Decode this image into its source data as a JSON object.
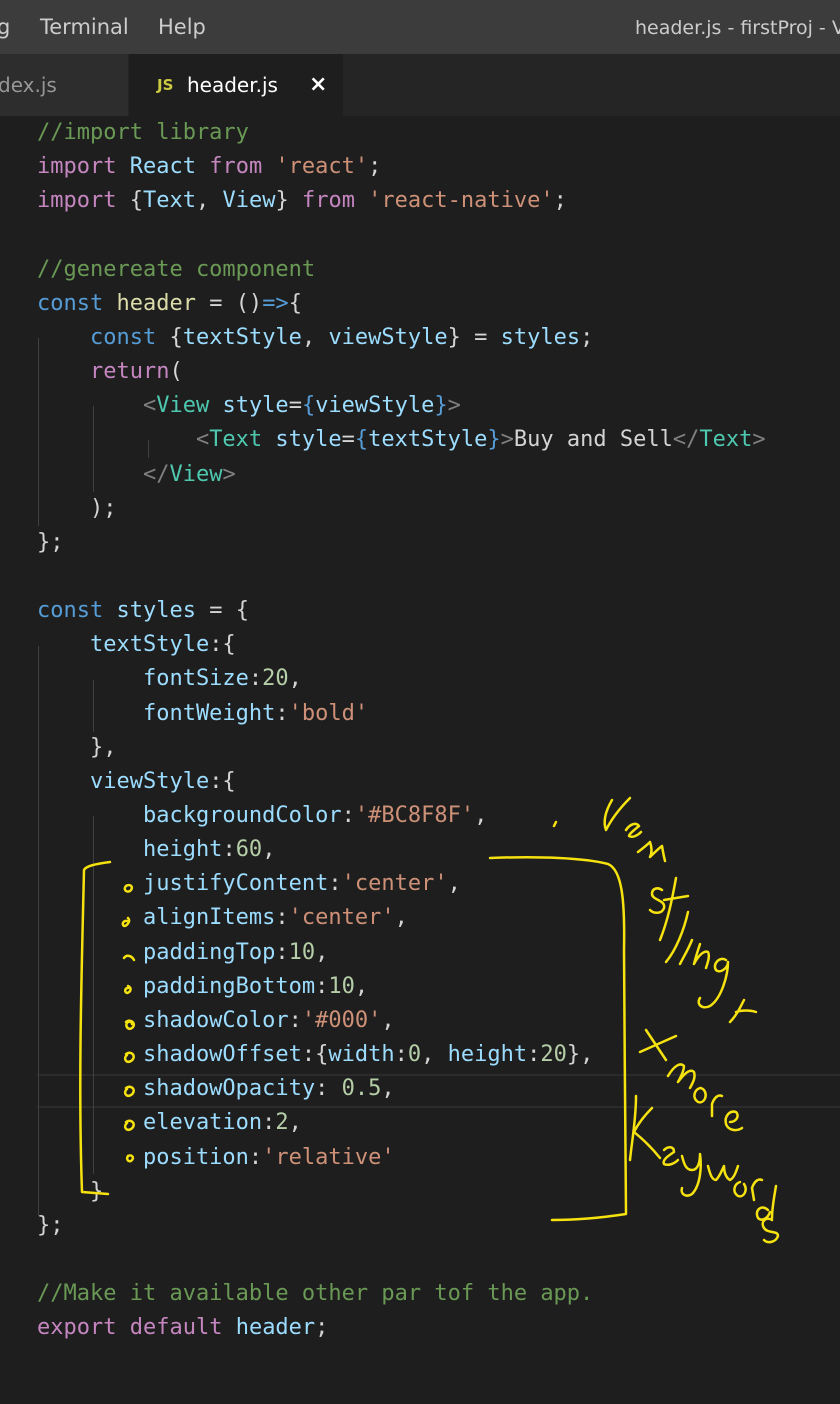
{
  "menubar": {
    "items": [
      "g",
      "Terminal",
      "Help"
    ],
    "title": "header.js - firstProj - V"
  },
  "tabs": {
    "inactive_label": "dex.js",
    "active_badge": "JS",
    "active_label": "header.js",
    "close_glyph": "×"
  },
  "code": {
    "lines": [
      [
        {
          "t": "//import library",
          "c": "comment"
        }
      ],
      [
        {
          "t": "import",
          "c": "kw"
        },
        {
          "t": " React ",
          "c": "var"
        },
        {
          "t": "from",
          "c": "kw"
        },
        {
          "t": " 'react'",
          "c": "str"
        },
        {
          "t": ";",
          "c": "punct"
        }
      ],
      [
        {
          "t": "import",
          "c": "kw"
        },
        {
          "t": " {",
          "c": "punct"
        },
        {
          "t": "Text",
          "c": "var"
        },
        {
          "t": ", ",
          "c": "punct"
        },
        {
          "t": "View",
          "c": "var"
        },
        {
          "t": "} ",
          "c": "punct"
        },
        {
          "t": "from",
          "c": "kw"
        },
        {
          "t": " 'react-native'",
          "c": "str"
        },
        {
          "t": ";",
          "c": "punct"
        }
      ],
      [],
      [
        {
          "t": "//genereate component",
          "c": "comment"
        }
      ],
      [
        {
          "t": "const",
          "c": "const"
        },
        {
          "t": " header",
          "c": "fn"
        },
        {
          "t": " = ()",
          "c": "punct"
        },
        {
          "t": "=>",
          "c": "const"
        },
        {
          "t": "{",
          "c": "punct"
        }
      ],
      [
        {
          "t": "    const",
          "c": "const"
        },
        {
          "t": " {",
          "c": "punct"
        },
        {
          "t": "textStyle",
          "c": "var"
        },
        {
          "t": ", ",
          "c": "punct"
        },
        {
          "t": "viewStyle",
          "c": "var"
        },
        {
          "t": "} = ",
          "c": "punct"
        },
        {
          "t": "styles",
          "c": "var"
        },
        {
          "t": ";",
          "c": "punct"
        }
      ],
      [
        {
          "t": "    return",
          "c": "kw"
        },
        {
          "t": "(",
          "c": "punct"
        }
      ],
      [
        {
          "t": "        <",
          "c": "brk"
        },
        {
          "t": "View",
          "c": "tag"
        },
        {
          "t": " style",
          "c": "var"
        },
        {
          "t": "=",
          "c": "punct"
        },
        {
          "t": "{",
          "c": "brace"
        },
        {
          "t": "viewStyle",
          "c": "var"
        },
        {
          "t": "}",
          "c": "brace"
        },
        {
          "t": ">",
          "c": "brk"
        }
      ],
      [
        {
          "t": "            <",
          "c": "brk"
        },
        {
          "t": "Text",
          "c": "tag"
        },
        {
          "t": " style",
          "c": "var"
        },
        {
          "t": "=",
          "c": "punct"
        },
        {
          "t": "{",
          "c": "brace"
        },
        {
          "t": "textStyle",
          "c": "var"
        },
        {
          "t": "}",
          "c": "brace"
        },
        {
          "t": ">",
          "c": "brk"
        },
        {
          "t": "Buy and Sell",
          "c": "punct"
        },
        {
          "t": "</",
          "c": "brk"
        },
        {
          "t": "Text",
          "c": "tag"
        },
        {
          "t": ">",
          "c": "brk"
        }
      ],
      [
        {
          "t": "        </",
          "c": "brk"
        },
        {
          "t": "View",
          "c": "tag"
        },
        {
          "t": ">",
          "c": "brk"
        }
      ],
      [
        {
          "t": "    );",
          "c": "punct"
        }
      ],
      [
        {
          "t": "};",
          "c": "punct"
        }
      ],
      [],
      [
        {
          "t": "const",
          "c": "const"
        },
        {
          "t": " styles",
          "c": "var"
        },
        {
          "t": " = {",
          "c": "punct"
        }
      ],
      [
        {
          "t": "    textStyle",
          "c": "var"
        },
        {
          "t": ":{",
          "c": "punct"
        }
      ],
      [
        {
          "t": "        fontSize",
          "c": "var"
        },
        {
          "t": ":",
          "c": "punct"
        },
        {
          "t": "20",
          "c": "num"
        },
        {
          "t": ",",
          "c": "punct"
        }
      ],
      [
        {
          "t": "        fontWeight",
          "c": "var"
        },
        {
          "t": ":",
          "c": "punct"
        },
        {
          "t": "'bold'",
          "c": "str"
        }
      ],
      [
        {
          "t": "    },",
          "c": "punct"
        }
      ],
      [
        {
          "t": "    viewStyle",
          "c": "var"
        },
        {
          "t": ":{",
          "c": "punct"
        }
      ],
      [
        {
          "t": "        backgroundColor",
          "c": "var"
        },
        {
          "t": ":",
          "c": "punct"
        },
        {
          "t": "'#BC8F8F'",
          "c": "str"
        },
        {
          "t": ",",
          "c": "punct"
        }
      ],
      [
        {
          "t": "        height",
          "c": "var"
        },
        {
          "t": ":",
          "c": "punct"
        },
        {
          "t": "60",
          "c": "num"
        },
        {
          "t": ",",
          "c": "punct"
        }
      ],
      [
        {
          "t": "        justifyContent",
          "c": "var"
        },
        {
          "t": ":",
          "c": "punct"
        },
        {
          "t": "'center'",
          "c": "str"
        },
        {
          "t": ",",
          "c": "punct"
        }
      ],
      [
        {
          "t": "        alignItems",
          "c": "var"
        },
        {
          "t": ":",
          "c": "punct"
        },
        {
          "t": "'center'",
          "c": "str"
        },
        {
          "t": ",",
          "c": "punct"
        }
      ],
      [
        {
          "t": "        paddingTop",
          "c": "var"
        },
        {
          "t": ":",
          "c": "punct"
        },
        {
          "t": "10",
          "c": "num"
        },
        {
          "t": ",",
          "c": "punct"
        }
      ],
      [
        {
          "t": "        paddingBottom",
          "c": "var"
        },
        {
          "t": ":",
          "c": "punct"
        },
        {
          "t": "10",
          "c": "num"
        },
        {
          "t": ",",
          "c": "punct"
        }
      ],
      [
        {
          "t": "        shadowColor",
          "c": "var"
        },
        {
          "t": ":",
          "c": "punct"
        },
        {
          "t": "'#000'",
          "c": "str"
        },
        {
          "t": ",",
          "c": "punct"
        }
      ],
      [
        {
          "t": "        shadowOffset",
          "c": "var"
        },
        {
          "t": ":{",
          "c": "punct"
        },
        {
          "t": "width",
          "c": "var"
        },
        {
          "t": ":",
          "c": "punct"
        },
        {
          "t": "0",
          "c": "num"
        },
        {
          "t": ", ",
          "c": "punct"
        },
        {
          "t": "height",
          "c": "var"
        },
        {
          "t": ":",
          "c": "punct"
        },
        {
          "t": "20",
          "c": "num"
        },
        {
          "t": "},",
          "c": "punct"
        }
      ],
      [
        {
          "t": "        shadowOpacity",
          "c": "var"
        },
        {
          "t": ": ",
          "c": "punct"
        },
        {
          "t": "0.5",
          "c": "num"
        },
        {
          "t": ",",
          "c": "punct"
        }
      ],
      [
        {
          "t": "        elevation",
          "c": "var"
        },
        {
          "t": ":",
          "c": "punct"
        },
        {
          "t": "2",
          "c": "num"
        },
        {
          "t": ",",
          "c": "punct"
        }
      ],
      [
        {
          "t": "        position",
          "c": "var"
        },
        {
          "t": ":",
          "c": "punct"
        },
        {
          "t": "'relative'",
          "c": "str"
        }
      ],
      [
        {
          "t": "    }",
          "c": "punct"
        }
      ],
      [
        {
          "t": "};",
          "c": "punct"
        }
      ],
      [],
      [
        {
          "t": "//Make it available other par tof the app.",
          "c": "comment"
        }
      ],
      [
        {
          "t": "export",
          "c": "kw"
        },
        {
          "t": " default",
          "c": "kw"
        },
        {
          "t": " header",
          "c": "var"
        },
        {
          "t": ";",
          "c": "punct"
        }
      ]
    ]
  },
  "annotation": {
    "text": "View styling + more keywords",
    "color": "#f5e20f"
  }
}
